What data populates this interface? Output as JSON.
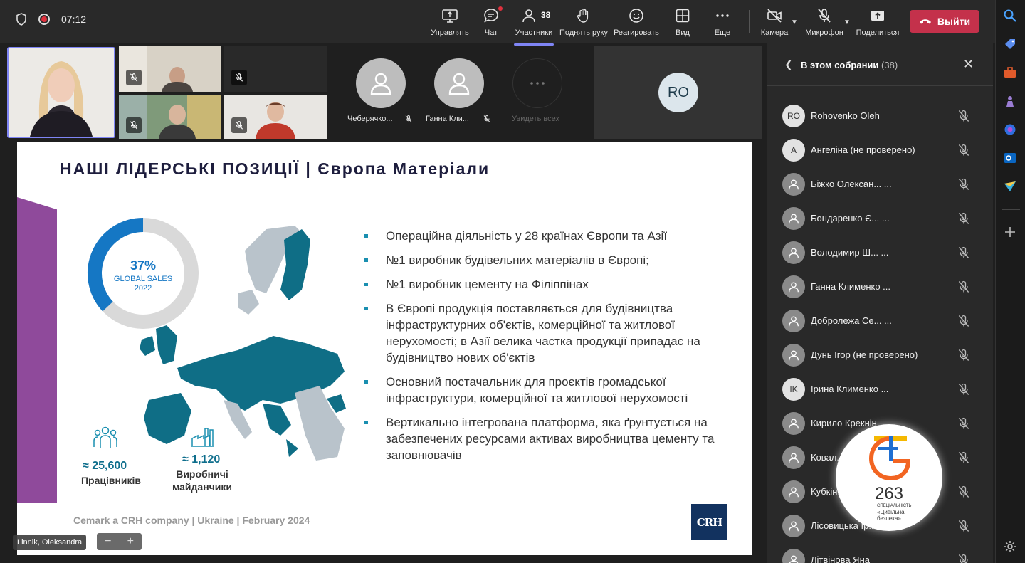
{
  "topbar": {
    "timer": "07:12",
    "tools": [
      {
        "label": "Управлять",
        "icon": "share-screen-icon"
      },
      {
        "label": "Чат",
        "icon": "chat-icon"
      },
      {
        "label": "Участники",
        "icon": "people-icon",
        "count": "38"
      },
      {
        "label": "Поднять руку",
        "icon": "raise-hand-icon"
      },
      {
        "label": "Реагировать",
        "icon": "smile-icon"
      },
      {
        "label": "Вид",
        "icon": "grid-view-icon"
      },
      {
        "label": "Еще",
        "icon": "more-icon"
      },
      {
        "label": "Камера",
        "icon": "camera-off-icon"
      },
      {
        "label": "Микрофон",
        "icon": "mic-off-icon"
      },
      {
        "label": "Поделиться",
        "icon": "share-icon"
      }
    ],
    "leave_label": "Выйти",
    "leave_color": "#c4314b",
    "accent_color": "#7f85f5"
  },
  "videos": {
    "avatars": [
      {
        "name": "Чеберячко..."
      },
      {
        "name": "Ганна Кли..."
      },
      {
        "name": "Увидеть всех"
      }
    ],
    "ro_initials": "RO"
  },
  "slide": {
    "title": "НАШІ ЛІДЕРСЬКІ ПОЗИЦІЇ | Європа Матеріали",
    "donut": {
      "percent": "37%",
      "label1": "GLOBAL SALES",
      "label2": "2022",
      "value": 0.37
    },
    "bullets": [
      "Операційна діяльність у 28 країнах Європи та Азії",
      "№1 виробник будівельних матеріалів в Європі;",
      "№1 виробник цементу на Філіппінах",
      "В Європі продукція поставляється для будівництва інфраструктурних об'єктів, комерційної та житлової нерухомості; в Азії велика частка продукції припадає на будівництво нових об'єктів",
      "Основний постачальник для проєктів громадської інфраструктури, комерційної та житлової нерухомості",
      "Вертикально інтегрована платформа, яка ґрунтується на забезпечених ресурсами активах виробництва цементу та заповнювачів"
    ],
    "stat1_num": "≈ 25,600",
    "stat1_label": "Працівників",
    "stat2_num": "≈ 1,120",
    "stat2_label1": "Виробничі",
    "stat2_label2": "майданчики",
    "footer": "Cemark a CRH company | Ukraine | February 2024",
    "logo": "CRH"
  },
  "presenter_tag": "Linnik, Oleksandra",
  "zoom": {
    "minus": "−",
    "plus": "+"
  },
  "panel": {
    "title": "В этом собрании",
    "count": "(38)",
    "participants": [
      {
        "name": "Rohovenko Oleh",
        "initials": "RO",
        "type": "initials-light"
      },
      {
        "name": "Ангеліна (не проверено)",
        "initials": "A",
        "type": "initials-light"
      },
      {
        "name": "Біжко Олексан... ...",
        "initials": "",
        "type": "person"
      },
      {
        "name": "Бондаренко Є... ...",
        "initials": "",
        "type": "person"
      },
      {
        "name": "Володимир Ш... ...",
        "initials": "",
        "type": "person"
      },
      {
        "name": "Ганна Клименко ...",
        "initials": "",
        "type": "person"
      },
      {
        "name": "Добролежа Се... ...",
        "initials": "",
        "type": "person"
      },
      {
        "name": "Дунь Ігор (не проверено)",
        "initials": "",
        "type": "person"
      },
      {
        "name": "Ірина Клименко ...",
        "initials": "IK",
        "type": "initials-light"
      },
      {
        "name": "Кирило Крекнін",
        "initials": "",
        "type": "person"
      },
      {
        "name": "Ковал...",
        "initials": "",
        "type": "person"
      },
      {
        "name": "Кубкін...",
        "initials": "",
        "type": "person"
      },
      {
        "name": "Лісовицька Ір...",
        "initials": "",
        "type": "person"
      },
      {
        "name": "Літвінова Яна",
        "initials": "",
        "type": "person"
      }
    ]
  },
  "watermark": {
    "number": "263",
    "sub1": "СПЕЦІАЛЬНІСТЬ",
    "sub2": "«Цивільна",
    "sub3": "безпека»"
  }
}
